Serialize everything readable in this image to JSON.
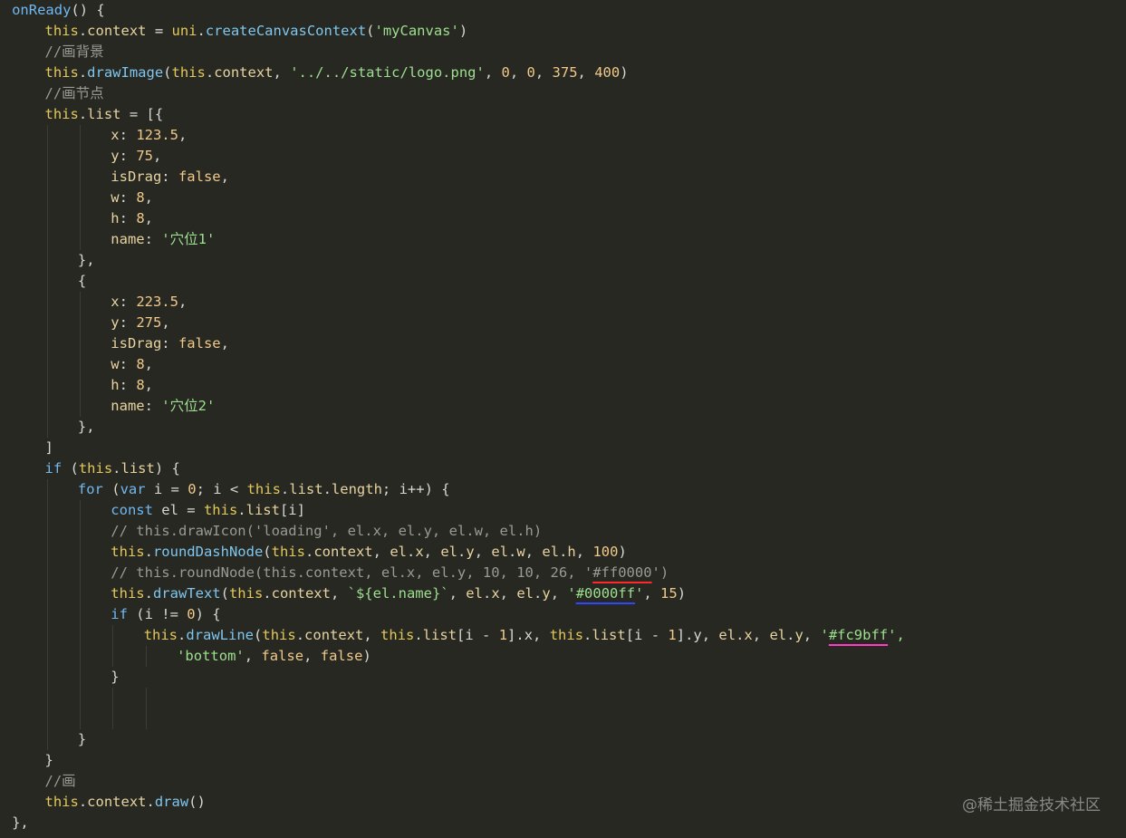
{
  "theme": {
    "background": "#272822",
    "colors": {
      "keyword": "#6fb8f2",
      "identifier": "#e2c85a",
      "method": "#7fc6ef",
      "string": "#9ddf8f",
      "number": "#f0c98a",
      "comment": "#9a9a92",
      "red_underline": "#ff2b2b",
      "blue_underline": "#2f48ff",
      "pink_underline": "#ff3cc6"
    }
  },
  "watermark": "@稀土掘金技术社区",
  "code": {
    "lines": [
      {
        "indent": 1,
        "tokens": [
          [
            "onReady",
            "kw"
          ],
          [
            "() {",
            "punct"
          ]
        ]
      },
      {
        "indent": 5,
        "tokens": [
          [
            "this",
            "ident"
          ],
          [
            ".",
            "punct"
          ],
          [
            "context",
            "prop"
          ],
          [
            " = ",
            "op"
          ],
          [
            "uni",
            "ident"
          ],
          [
            ".",
            "punct"
          ],
          [
            "createCanvasContext",
            "method"
          ],
          [
            "(",
            "punct"
          ],
          [
            "'myCanvas'",
            "str"
          ],
          [
            ")",
            "punct"
          ]
        ]
      },
      {
        "indent": 5,
        "tokens": [
          [
            "//画背景",
            "comment"
          ]
        ]
      },
      {
        "indent": 5,
        "tokens": [
          [
            "this",
            "ident"
          ],
          [
            ".",
            "punct"
          ],
          [
            "drawImage",
            "method"
          ],
          [
            "(",
            "punct"
          ],
          [
            "this",
            "ident"
          ],
          [
            ".",
            "punct"
          ],
          [
            "context",
            "prop"
          ],
          [
            ", ",
            "punct"
          ],
          [
            "'../../static/logo.png'",
            "str"
          ],
          [
            ", ",
            "punct"
          ],
          [
            "0",
            "num"
          ],
          [
            ", ",
            "punct"
          ],
          [
            "0",
            "num"
          ],
          [
            ", ",
            "punct"
          ],
          [
            "375",
            "num"
          ],
          [
            ", ",
            "punct"
          ],
          [
            "400",
            "num"
          ],
          [
            ")",
            "punct"
          ]
        ]
      },
      {
        "indent": 5,
        "tokens": [
          [
            "//画节点",
            "comment"
          ]
        ]
      },
      {
        "indent": 5,
        "tokens": [
          [
            "this",
            "ident"
          ],
          [
            ".",
            "punct"
          ],
          [
            "list",
            "prop"
          ],
          [
            " = [{",
            "punct"
          ]
        ]
      },
      {
        "indent": 13,
        "tokens": [
          [
            "x",
            "prop"
          ],
          [
            ": ",
            "punct"
          ],
          [
            "123.5",
            "num"
          ],
          [
            ",",
            "punct"
          ]
        ]
      },
      {
        "indent": 13,
        "tokens": [
          [
            "y",
            "prop"
          ],
          [
            ": ",
            "punct"
          ],
          [
            "75",
            "num"
          ],
          [
            ",",
            "punct"
          ]
        ]
      },
      {
        "indent": 13,
        "tokens": [
          [
            "isDrag",
            "prop"
          ],
          [
            ": ",
            "punct"
          ],
          [
            "false",
            "bool"
          ],
          [
            ",",
            "punct"
          ]
        ]
      },
      {
        "indent": 13,
        "tokens": [
          [
            "w",
            "prop"
          ],
          [
            ": ",
            "punct"
          ],
          [
            "8",
            "num"
          ],
          [
            ",",
            "punct"
          ]
        ]
      },
      {
        "indent": 13,
        "tokens": [
          [
            "h",
            "prop"
          ],
          [
            ": ",
            "punct"
          ],
          [
            "8",
            "num"
          ],
          [
            ",",
            "punct"
          ]
        ]
      },
      {
        "indent": 13,
        "tokens": [
          [
            "name",
            "prop"
          ],
          [
            ": ",
            "punct"
          ],
          [
            "'穴位1'",
            "str"
          ]
        ]
      },
      {
        "indent": 9,
        "tokens": [
          [
            "},",
            "punct"
          ]
        ]
      },
      {
        "indent": 9,
        "tokens": [
          [
            "{",
            "punct"
          ]
        ]
      },
      {
        "indent": 13,
        "tokens": [
          [
            "x",
            "prop"
          ],
          [
            ": ",
            "punct"
          ],
          [
            "223.5",
            "num"
          ],
          [
            ",",
            "punct"
          ]
        ]
      },
      {
        "indent": 13,
        "tokens": [
          [
            "y",
            "prop"
          ],
          [
            ": ",
            "punct"
          ],
          [
            "275",
            "num"
          ],
          [
            ",",
            "punct"
          ]
        ]
      },
      {
        "indent": 13,
        "tokens": [
          [
            "isDrag",
            "prop"
          ],
          [
            ": ",
            "punct"
          ],
          [
            "false",
            "bool"
          ],
          [
            ",",
            "punct"
          ]
        ]
      },
      {
        "indent": 13,
        "tokens": [
          [
            "w",
            "prop"
          ],
          [
            ": ",
            "punct"
          ],
          [
            "8",
            "num"
          ],
          [
            ",",
            "punct"
          ]
        ]
      },
      {
        "indent": 13,
        "tokens": [
          [
            "h",
            "prop"
          ],
          [
            ": ",
            "punct"
          ],
          [
            "8",
            "num"
          ],
          [
            ",",
            "punct"
          ]
        ]
      },
      {
        "indent": 13,
        "tokens": [
          [
            "name",
            "prop"
          ],
          [
            ": ",
            "punct"
          ],
          [
            "'穴位2'",
            "str"
          ]
        ]
      },
      {
        "indent": 9,
        "tokens": [
          [
            "},",
            "punct"
          ]
        ]
      },
      {
        "indent": 5,
        "tokens": [
          [
            "]",
            "punct"
          ]
        ]
      },
      {
        "indent": 5,
        "tokens": [
          [
            "if",
            "kw"
          ],
          [
            " (",
            "punct"
          ],
          [
            "this",
            "ident"
          ],
          [
            ".",
            "punct"
          ],
          [
            "list",
            "prop"
          ],
          [
            ") {",
            "punct"
          ]
        ]
      },
      {
        "indent": 9,
        "tokens": [
          [
            "for",
            "kw"
          ],
          [
            " (",
            "punct"
          ],
          [
            "var",
            "kw"
          ],
          [
            " i = ",
            "plain"
          ],
          [
            "0",
            "num"
          ],
          [
            "; i < ",
            "plain"
          ],
          [
            "this",
            "ident"
          ],
          [
            ".",
            "punct"
          ],
          [
            "list",
            "prop"
          ],
          [
            ".",
            "punct"
          ],
          [
            "length",
            "prop"
          ],
          [
            "; i++) {",
            "plain"
          ]
        ]
      },
      {
        "indent": 13,
        "tokens": [
          [
            "const",
            "kw"
          ],
          [
            " el = ",
            "plain"
          ],
          [
            "this",
            "ident"
          ],
          [
            ".",
            "punct"
          ],
          [
            "list",
            "prop"
          ],
          [
            "[i]",
            "punct"
          ]
        ]
      },
      {
        "indent": 13,
        "tokens": [
          [
            "// this.drawIcon('loading', el.x, el.y, el.w, el.h)",
            "comment"
          ]
        ]
      },
      {
        "indent": 13,
        "tokens": [
          [
            "this",
            "ident"
          ],
          [
            ".",
            "punct"
          ],
          [
            "roundDashNode",
            "method"
          ],
          [
            "(",
            "punct"
          ],
          [
            "this",
            "ident"
          ],
          [
            ".",
            "punct"
          ],
          [
            "context",
            "prop"
          ],
          [
            ", ",
            "punct"
          ],
          [
            "el",
            "prop"
          ],
          [
            ".",
            "punct"
          ],
          [
            "x",
            "prop"
          ],
          [
            ", ",
            "punct"
          ],
          [
            "el",
            "prop"
          ],
          [
            ".",
            "punct"
          ],
          [
            "y",
            "prop"
          ],
          [
            ", ",
            "punct"
          ],
          [
            "el",
            "prop"
          ],
          [
            ".",
            "punct"
          ],
          [
            "w",
            "prop"
          ],
          [
            ", ",
            "punct"
          ],
          [
            "el",
            "prop"
          ],
          [
            ".",
            "punct"
          ],
          [
            "h",
            "prop"
          ],
          [
            ", ",
            "punct"
          ],
          [
            "100",
            "num"
          ],
          [
            ")",
            "punct"
          ]
        ]
      },
      {
        "indent": 13,
        "tokens": [
          [
            "// this.roundNode(this.context, el.x, el.y, 10, 10, 26, '",
            "comment"
          ],
          [
            "#ff0000",
            "comment",
            "u-red"
          ],
          [
            "')",
            "comment"
          ]
        ]
      },
      {
        "indent": 13,
        "tokens": [
          [
            "this",
            "ident"
          ],
          [
            ".",
            "punct"
          ],
          [
            "drawText",
            "method"
          ],
          [
            "(",
            "punct"
          ],
          [
            "this",
            "ident"
          ],
          [
            ".",
            "punct"
          ],
          [
            "context",
            "prop"
          ],
          [
            ", ",
            "punct"
          ],
          [
            "`${el.name}`",
            "str"
          ],
          [
            ", ",
            "punct"
          ],
          [
            "el",
            "prop"
          ],
          [
            ".",
            "punct"
          ],
          [
            "x",
            "prop"
          ],
          [
            ", ",
            "punct"
          ],
          [
            "el",
            "prop"
          ],
          [
            ".",
            "punct"
          ],
          [
            "y",
            "prop"
          ],
          [
            ", ",
            "punct"
          ],
          [
            "'",
            "str"
          ],
          [
            "#0000ff",
            "str",
            "u-blue"
          ],
          [
            "'",
            "str"
          ],
          [
            ", ",
            "punct"
          ],
          [
            "15",
            "num"
          ],
          [
            ")",
            "punct"
          ]
        ]
      },
      {
        "indent": 13,
        "tokens": [
          [
            "if",
            "kw"
          ],
          [
            " (i != ",
            "plain"
          ],
          [
            "0",
            "num"
          ],
          [
            ") {",
            "punct"
          ]
        ]
      },
      {
        "indent": 17,
        "tokens": [
          [
            "this",
            "ident"
          ],
          [
            ".",
            "punct"
          ],
          [
            "drawLine",
            "method"
          ],
          [
            "(",
            "punct"
          ],
          [
            "this",
            "ident"
          ],
          [
            ".",
            "punct"
          ],
          [
            "context",
            "prop"
          ],
          [
            ", ",
            "punct"
          ],
          [
            "this",
            "ident"
          ],
          [
            ".",
            "punct"
          ],
          [
            "list",
            "prop"
          ],
          [
            "[i - ",
            "punct"
          ],
          [
            "1",
            "num"
          ],
          [
            "].x, ",
            "punct"
          ],
          [
            "this",
            "ident"
          ],
          [
            ".",
            "punct"
          ],
          [
            "list",
            "prop"
          ],
          [
            "[i - ",
            "punct"
          ],
          [
            "1",
            "num"
          ],
          [
            "].y, ",
            "punct"
          ],
          [
            "el",
            "prop"
          ],
          [
            ".",
            "punct"
          ],
          [
            "x",
            "prop"
          ],
          [
            ", ",
            "punct"
          ],
          [
            "el",
            "prop"
          ],
          [
            ".",
            "punct"
          ],
          [
            "y",
            "prop"
          ],
          [
            ", ",
            "punct"
          ],
          [
            "'",
            "str"
          ],
          [
            "#fc9bff",
            "str",
            "u-pink"
          ],
          [
            "',",
            "str"
          ]
        ]
      },
      {
        "indent": 21,
        "tokens": [
          [
            "'bottom'",
            "str"
          ],
          [
            ", ",
            "punct"
          ],
          [
            "false",
            "bool"
          ],
          [
            ", ",
            "punct"
          ],
          [
            "false",
            "bool"
          ],
          [
            ")",
            "punct"
          ]
        ]
      },
      {
        "indent": 13,
        "tokens": [
          [
            "}",
            "punct"
          ]
        ]
      },
      {
        "indent": 0,
        "tokens": []
      },
      {
        "indent": 0,
        "tokens": []
      },
      {
        "indent": 9,
        "tokens": [
          [
            "}",
            "punct"
          ]
        ]
      },
      {
        "indent": 5,
        "tokens": [
          [
            "}",
            "punct"
          ]
        ]
      },
      {
        "indent": 5,
        "tokens": [
          [
            "//画",
            "comment"
          ]
        ]
      },
      {
        "indent": 5,
        "tokens": [
          [
            "this",
            "ident"
          ],
          [
            ".",
            "punct"
          ],
          [
            "context",
            "prop"
          ],
          [
            ".",
            "punct"
          ],
          [
            "draw",
            "method"
          ],
          [
            "()",
            "punct"
          ]
        ]
      },
      {
        "indent": 1,
        "tokens": [
          [
            "},",
            "punct"
          ]
        ]
      }
    ]
  }
}
